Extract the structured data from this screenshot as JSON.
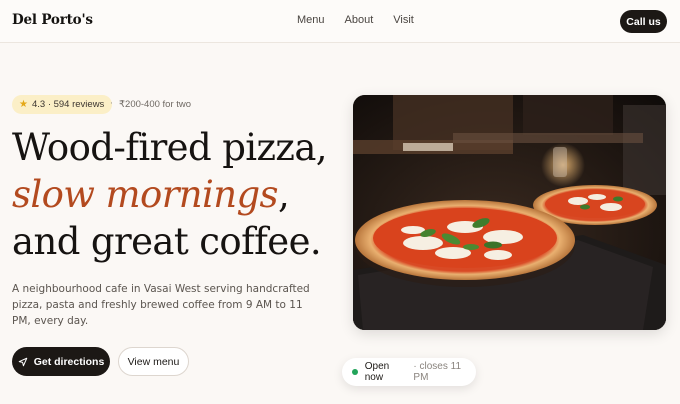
{
  "nav": {
    "brand": "Del Porto's",
    "links": [
      "Menu",
      "About",
      "Visit"
    ],
    "cta": "Call us"
  },
  "hero": {
    "rating": "4.3 · 594 reviews",
    "separator": "·",
    "price": "₹200-400 for two",
    "headline_line1": "Wood-fired pizza,",
    "headline_accent": "slow mornings",
    "headline_comma": ",",
    "headline_line3": "and great coffee.",
    "description": "A neighbourhood cafe in Vasai West serving handcrafted pizza, pasta and freshly brewed coffee from 9 AM to 11 PM, every day.",
    "primary_button": "Get directions",
    "secondary_button": "View menu"
  },
  "status": {
    "open_label": "Open now",
    "closes_label": "· closes 11 PM"
  },
  "colors": {
    "accent": "#b34a1f",
    "dark": "#1c1815",
    "rating_bg": "#fbefc7",
    "open_dot": "#22a45a"
  },
  "icons": {
    "rating": "star-icon",
    "directions": "navigation-arrow-icon",
    "status": "status-dot-icon"
  }
}
